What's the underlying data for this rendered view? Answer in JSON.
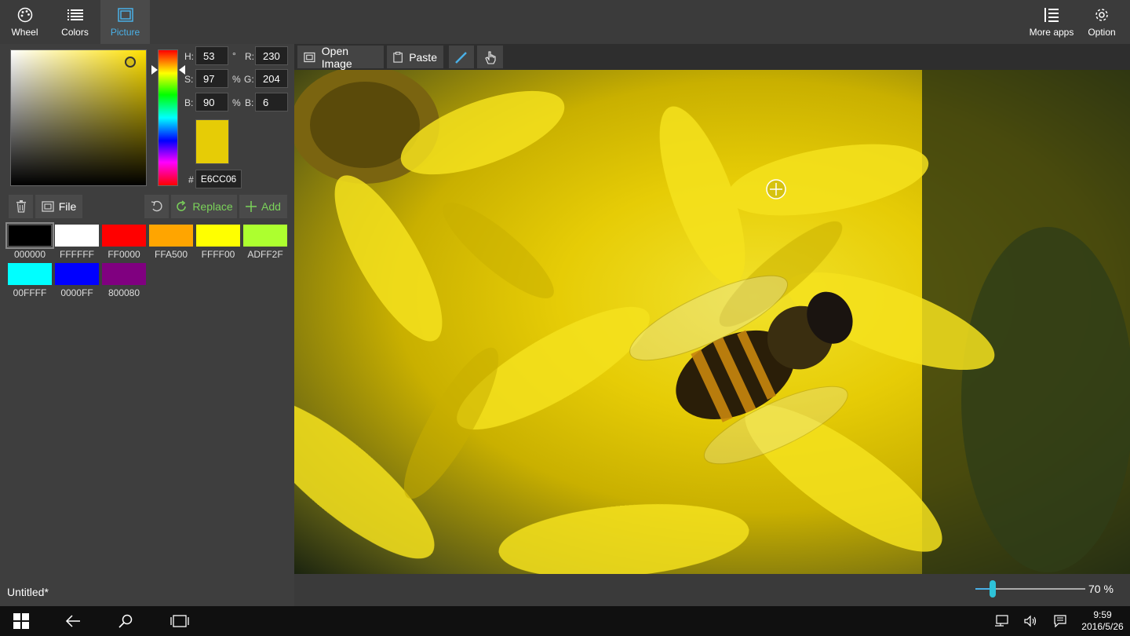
{
  "nav": {
    "wheel": "Wheel",
    "colors": "Colors",
    "picture": "Picture",
    "more_apps": "More apps",
    "option": "Option"
  },
  "picker": {
    "h_label": "H:",
    "h_value": "53",
    "h_unit": "°",
    "s_label": "S:",
    "s_value": "97",
    "s_unit": "%",
    "b_label": "B:",
    "b_value": "90",
    "b_unit": "%",
    "r_label": "R:",
    "r_value": "230",
    "g_label": "G:",
    "g_value": "204",
    "bb_label": "B:",
    "bb_value": "6",
    "hash": "#",
    "hex": "E6CC06",
    "current_color": "#E6CC06"
  },
  "palette_toolbar": {
    "file": "File",
    "replace": "Replace",
    "add": "Add"
  },
  "palette": [
    {
      "hex": "000000",
      "color": "#000000"
    },
    {
      "hex": "FFFFFF",
      "color": "#FFFFFF"
    },
    {
      "hex": "FF0000",
      "color": "#FF0000"
    },
    {
      "hex": "FFA500",
      "color": "#FFA500"
    },
    {
      "hex": "FFFF00",
      "color": "#FFFF00"
    },
    {
      "hex": "ADFF2F",
      "color": "#ADFF2F"
    },
    {
      "hex": "00FFFF",
      "color": "#00FFFF"
    },
    {
      "hex": "0000FF",
      "color": "#0000FF"
    },
    {
      "hex": "800080",
      "color": "#800080"
    }
  ],
  "document_title": "Untitled*",
  "image_toolbar": {
    "open_image": "Open Image",
    "paste": "Paste"
  },
  "zoom": {
    "label": "70 %",
    "value": 70
  },
  "taskbar": {
    "time": "9:59",
    "date": "2016/5/26"
  },
  "colors": {
    "accent": "#4ab0e6",
    "slider_thumb": "#2ec2d8",
    "add_green": "#7bd35a"
  }
}
